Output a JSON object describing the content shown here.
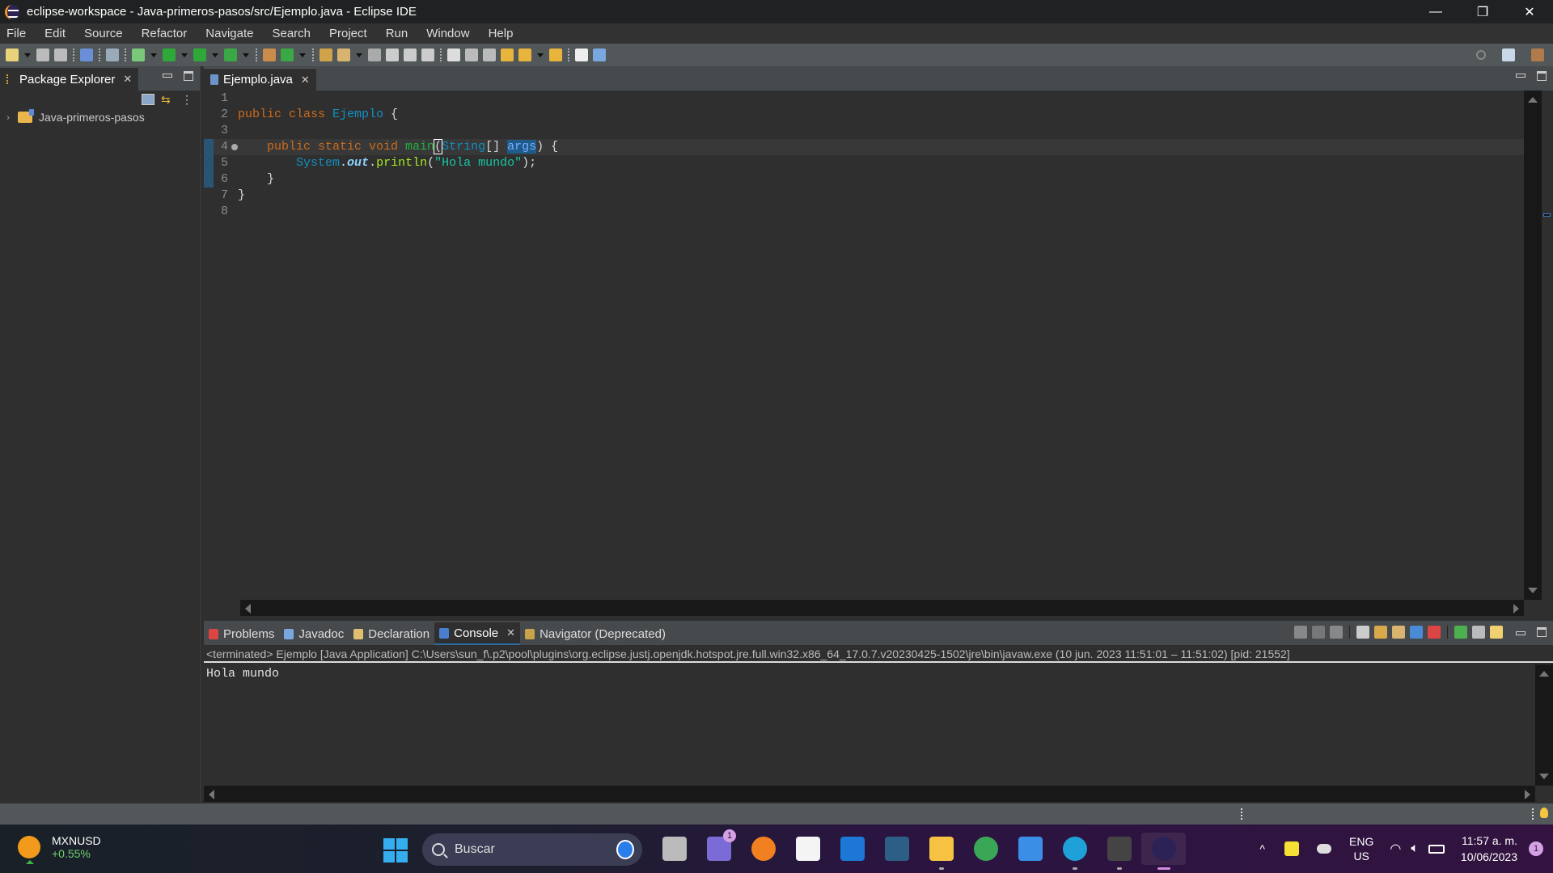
{
  "window": {
    "title": "eclipse-workspace - Java-primeros-pasos/src/Ejemplo.java - Eclipse IDE",
    "controls": {
      "minimize": "—",
      "restore": "❐",
      "close": "✕"
    }
  },
  "menu": [
    "File",
    "Edit",
    "Source",
    "Refactor",
    "Navigate",
    "Search",
    "Project",
    "Run",
    "Window",
    "Help"
  ],
  "toolbar": {
    "icons": [
      "new-icon",
      "save-icon",
      "save-all-icon",
      "terminal-icon",
      "skip-breakpoints-icon",
      "debug-icon",
      "run-icon",
      "coverage-icon",
      "external-tools-icon",
      "new-package-icon",
      "new-class-icon",
      "open-type-icon",
      "pen-icon",
      "toggle-annotation-icon",
      "mark-occurrences-icon",
      "word-wrap-icon",
      "block-selection-icon",
      "show-whitespace-icon",
      "next-annotation-icon",
      "previous-annotation-icon",
      "last-edit-icon",
      "forward-edit-icon",
      "back-icon",
      "forward-icon",
      "pin-editor-icon"
    ],
    "right_icons": [
      "search-icon",
      "open-perspective-icon",
      "java-perspective-icon"
    ]
  },
  "package_explorer": {
    "tab_label": "Package Explorer",
    "tree": [
      {
        "label": "Java-primeros-pasos",
        "expanded": false
      }
    ]
  },
  "editor": {
    "tab_label": "Ejemplo.java",
    "lines": [
      {
        "n": "1",
        "tokens": []
      },
      {
        "n": "2",
        "tokens": [
          {
            "t": "public class ",
            "c": "kw"
          },
          {
            "t": "Ejemplo",
            "c": "cls"
          },
          {
            "t": " {",
            "c": ""
          }
        ]
      },
      {
        "n": "3",
        "tokens": []
      },
      {
        "n": "4",
        "tokens": [
          {
            "t": "    public static void ",
            "c": "kw"
          },
          {
            "t": "main",
            "c": "mth"
          },
          {
            "t": "(",
            "c": "sel-bracket"
          },
          {
            "t": "String",
            "c": "cls"
          },
          {
            "t": "[] ",
            "c": ""
          },
          {
            "t": "args",
            "c": "param"
          },
          {
            "t": ") {",
            "c": ""
          }
        ]
      },
      {
        "n": "5",
        "tokens": [
          {
            "t": "        ",
            "c": ""
          },
          {
            "t": "System",
            "c": "cls"
          },
          {
            "t": ".",
            "c": ""
          },
          {
            "t": "out",
            "c": "fld"
          },
          {
            "t": ".",
            "c": ""
          },
          {
            "t": "println",
            "c": "call"
          },
          {
            "t": "(",
            "c": ""
          },
          {
            "t": "\"Hola mundo\"",
            "c": "str"
          },
          {
            "t": ");",
            "c": ""
          }
        ]
      },
      {
        "n": "6",
        "tokens": [
          {
            "t": "    }",
            "c": ""
          }
        ]
      },
      {
        "n": "7",
        "tokens": [
          {
            "t": "}",
            "c": ""
          }
        ]
      },
      {
        "n": "8",
        "tokens": []
      }
    ],
    "current_line": 4
  },
  "console_panel": {
    "tabs": [
      {
        "label": "Problems",
        "icon": "problems-icon",
        "color": "#d44"
      },
      {
        "label": "Javadoc",
        "icon": "javadoc-icon",
        "color": "#7aa7e0"
      },
      {
        "label": "Declaration",
        "icon": "declaration-icon",
        "color": "#e0c070"
      },
      {
        "label": "Console",
        "icon": "console-icon",
        "color": "#4a7fd0",
        "active": true
      },
      {
        "label": "Navigator (Deprecated)",
        "icon": "navigator-icon",
        "color": "#c9a24a"
      }
    ],
    "header": "<terminated> Ejemplo [Java Application] C:\\Users\\sun_f\\.p2\\pool\\plugins\\org.eclipse.justj.openjdk.hotspot.jre.full.win32.x86_64_17.0.7.v20230425-1502\\jre\\bin\\javaw.exe  (10 jun. 2023 11:51:01 – 11:51:02) [pid: 21552]",
    "output": "Hola mundo",
    "tool_icons": [
      "terminate-icon",
      "remove-launch-icon",
      "remove-all-terminated-icon",
      "clear-console-icon",
      "scroll-lock-icon",
      "word-wrap-icon",
      "show-on-stdout-icon",
      "show-on-stderr-icon",
      "pin-console-icon",
      "display-console-icon",
      "open-console-icon"
    ]
  },
  "taskbar": {
    "widget": {
      "symbol": "MXNUSD",
      "change": "+0.55%"
    },
    "search_placeholder": "Buscar",
    "apps": [
      {
        "name": "task-view",
        "color": "#bbb"
      },
      {
        "name": "teams-chat",
        "color": "#7b6bd6",
        "badge": "1"
      },
      {
        "name": "avast-secure-browser",
        "color": "#f08020"
      },
      {
        "name": "microsoft-store",
        "color": "#f4f4f4"
      },
      {
        "name": "windows-app",
        "color": "#1c78d4"
      },
      {
        "name": "mysql-workbench",
        "color": "#2d5f86"
      },
      {
        "name": "file-explorer",
        "color": "#f5c242",
        "running": true
      },
      {
        "name": "chrome",
        "color": "#3aa757"
      },
      {
        "name": "notepad",
        "color": "#3a8ee6"
      },
      {
        "name": "edge",
        "color": "#1fa0d8",
        "running": true
      },
      {
        "name": "terminal",
        "color": "#444",
        "running": true
      },
      {
        "name": "eclipse",
        "color": "#2c2255",
        "active": true
      }
    ],
    "tray": {
      "lang1": "ENG",
      "lang2": "US",
      "time": "11:57 a. m.",
      "date": "10/06/2023",
      "notifications": "1"
    }
  }
}
